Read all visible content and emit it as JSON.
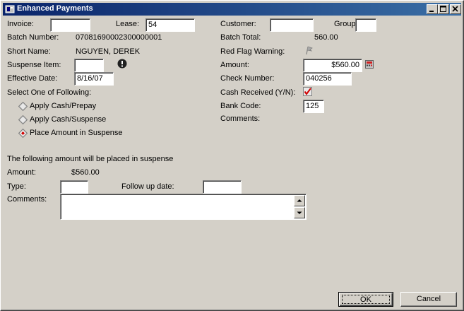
{
  "window": {
    "title": "Enhanced Payments"
  },
  "left": {
    "invoice_label": "Invoice:",
    "invoice_value": "",
    "lease_label": "Lease:",
    "lease_value": "54",
    "batch_number_label": "Batch Number:",
    "batch_number_value": "07081690002300000001",
    "short_name_label": "Short Name:",
    "short_name_value": "NGUYEN, DEREK",
    "suspense_item_label": "Suspense Item:",
    "suspense_item_value": "",
    "effective_date_label": "Effective Date:",
    "effective_date_value": "8/16/07",
    "select_label": "Select One of Following:",
    "options": [
      {
        "label": "Apply Cash/Prepay",
        "selected": false
      },
      {
        "label": "Apply Cash/Suspense",
        "selected": false
      },
      {
        "label": "Place Amount in Suspense",
        "selected": true
      }
    ]
  },
  "right": {
    "customer_label": "Customer:",
    "customer_value": "",
    "group_label": "Group",
    "group_value": "",
    "batch_total_label": "Batch Total:",
    "batch_total_value": "560.00",
    "red_flag_label": "Red Flag Warning:",
    "amount_label": "Amount:",
    "amount_value": "$560.00",
    "check_number_label": "Check Number:",
    "check_number_value": "040256",
    "cash_received_label": "Cash Received (Y/N):",
    "cash_received_checked": true,
    "bank_code_label": "Bank Code:",
    "bank_code_value": "125",
    "comments_label": "Comments:"
  },
  "suspense": {
    "heading": "The following amount will be placed in suspense",
    "amount_label": "Amount:",
    "amount_value": "$560.00",
    "type_label": "Type:",
    "type_value": "",
    "follow_up_label": "Follow up date:",
    "follow_up_value": "",
    "comments_label": "Comments:",
    "comments_value": ""
  },
  "buttons": {
    "ok": "OK",
    "cancel": "Cancel"
  },
  "icons": {
    "app": "app-icon",
    "warning": "exclamation-icon",
    "red_flag": "flag-icon",
    "calculator": "calculator-icon",
    "checkbox": "checkbox-checked-icon"
  }
}
